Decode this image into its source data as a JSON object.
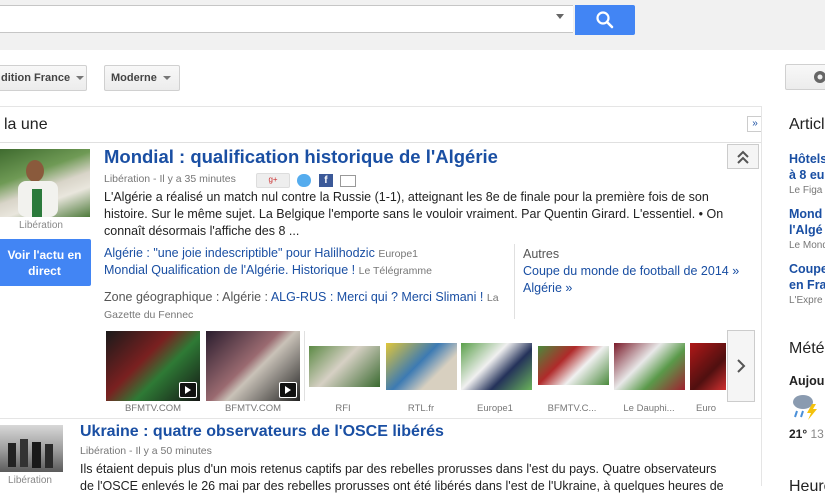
{
  "header": {
    "edition_label": "dition France",
    "view_label": "Moderne"
  },
  "section": {
    "title": "la une",
    "expand_label": "»"
  },
  "story1": {
    "thumb_source": "Libération",
    "title": "Mondial : qualification historique de l'Algérie",
    "meta": "Libération - Il y a 35 minutes",
    "snippet": "L'Algérie a réalisé un match nul contre la Russie (1-1), atteignant les 8e de finale pour la première fois de son histoire. Sur le même sujet. La Belgique l'emporte sans le vouloir vraiment. Par Quentin Girard. L'essentiel. • On connaît désormais l'affiche des 8 ...",
    "live_button": "Voir l'actu en direct",
    "related": [
      {
        "text": "Algérie : \"une joie indescriptible\" pour Halilhodzic",
        "source": "Europe1"
      },
      {
        "text": "Mondial Qualification de l'Algérie. Historique !",
        "source": "Le Télégramme"
      }
    ],
    "geo_prefix": "Zone géographique : Algérie :",
    "geo_link": "ALG-RUS : Merci qui ? Merci Slimani !",
    "geo_source": "La Gazette du Fennec",
    "autres_label": "Autres",
    "autres_links": [
      "Coupe du monde de football de 2014 »",
      "Algérie »"
    ],
    "media": [
      {
        "caption": "BFMTV.COM",
        "video": true
      },
      {
        "caption": "BFMTV.COM",
        "video": true
      },
      {
        "caption": "RFI",
        "video": false
      },
      {
        "caption": "RTL.fr",
        "video": false
      },
      {
        "caption": "Europe1",
        "video": false
      },
      {
        "caption": "BFMTV.C...",
        "video": false
      },
      {
        "caption": "Le Dauphi...",
        "video": false
      },
      {
        "caption": "Euro",
        "video": false
      }
    ]
  },
  "story2": {
    "thumb_source": "Libération",
    "title": "Ukraine : quatre observateurs de l'OSCE libérés",
    "meta": "Libération - Il y a 50 minutes",
    "snippet_line1": "Ils étaient depuis plus d'un mois retenus captifs par des rebelles prorusses dans l'est du pays. Quatre observateurs",
    "snippet_line2": "de l'OSCE enlevés le 26 mai par des rebelles prorusses ont été libérés dans l'est de l'Ukraine, à quelques heures de"
  },
  "rightcol": {
    "heading": "Articl",
    "items": [
      {
        "line1": "Hôtels",
        "line2": "à 8 eu",
        "source": "Le Figa"
      },
      {
        "line1": "Mond",
        "line2": "l'Algé",
        "source": "Le Mond"
      },
      {
        "line1": "Coupe",
        "line2": "en Fra",
        "source": "L'Expre"
      }
    ],
    "weather_heading": "Mété",
    "weather_day": "Aujou",
    "temp_high": "21°",
    "temp_low": "13",
    "bottom_heading": "Heure"
  },
  "colors": {
    "link": "#1a4fa3",
    "button_blue": "#4285f4",
    "meta_grey": "#777777"
  }
}
